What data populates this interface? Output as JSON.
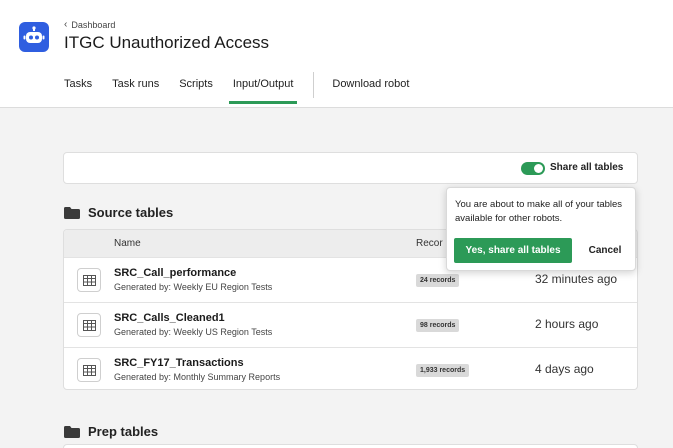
{
  "header": {
    "breadcrumb": "Dashboard",
    "title": "ITGC Unauthorized Access",
    "app_icon": "robot-icon",
    "accent": "#2f5ee0"
  },
  "tabs": [
    {
      "label": "Tasks",
      "active": false
    },
    {
      "label": "Task runs",
      "active": false
    },
    {
      "label": "Scripts",
      "active": false
    },
    {
      "label": "Input/Output",
      "active": true
    },
    {
      "label": "Download robot",
      "active": false
    }
  ],
  "share": {
    "label": "Share all tables",
    "toggle_on": true,
    "toggle_color": "#2c9a57"
  },
  "source_section": {
    "title": "Source tables",
    "columns": {
      "name": "Name",
      "records": "Recor"
    },
    "rows": [
      {
        "name": "SRC_Call_performance",
        "generated_by": "Generated by: Weekly EU Region Tests",
        "records": "24 records",
        "time": "32 minutes ago"
      },
      {
        "name": "SRC_Calls_Cleaned1",
        "generated_by": "Generated by: Weekly US Region Tests",
        "records": "98 records",
        "time": "2 hours ago"
      },
      {
        "name": "SRC_FY17_Transactions",
        "generated_by": "Generated by: Monthly Summary Reports",
        "records": "1,933 records",
        "time": "4 days ago"
      }
    ]
  },
  "popover": {
    "message": "You are about to make all of your tables available for other robots.",
    "confirm_label": "Yes, share all tables",
    "cancel_label": "Cancel"
  },
  "prep_section": {
    "title": "Prep tables"
  }
}
